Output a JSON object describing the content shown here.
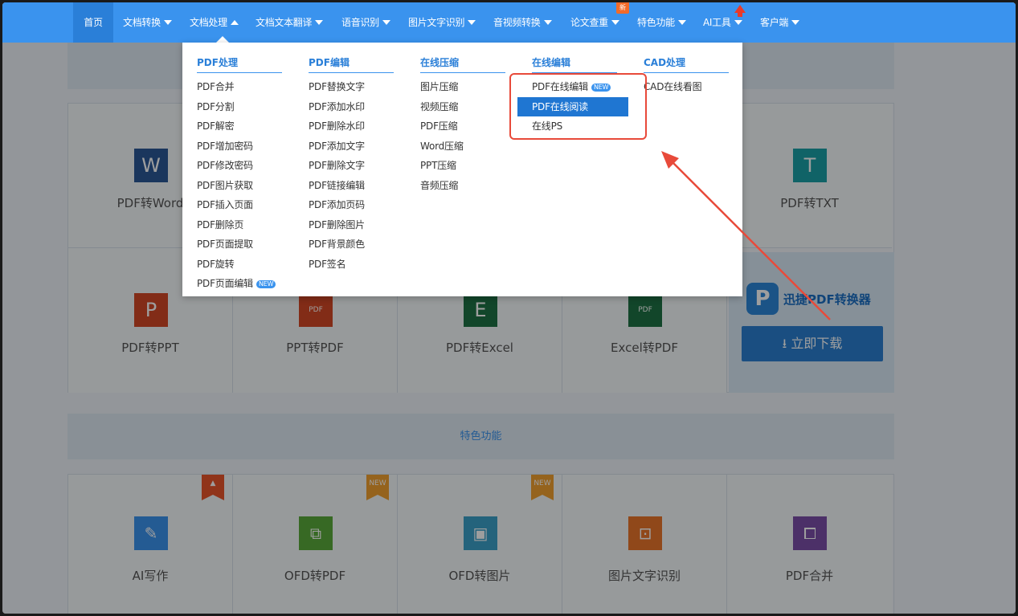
{
  "nav": {
    "items": [
      {
        "label": "首页"
      },
      {
        "label": "文档转换"
      },
      {
        "label": "文档处理"
      },
      {
        "label": "文档文本翻译"
      },
      {
        "label": "语音识别"
      },
      {
        "label": "图片文字识别"
      },
      {
        "label": "音视频转换"
      },
      {
        "label": "论文查重"
      },
      {
        "label": "特色功能"
      },
      {
        "label": "AI工具"
      },
      {
        "label": "客户端"
      }
    ],
    "new_badge": "新"
  },
  "dropdown": {
    "columns": [
      {
        "title": "PDF处理",
        "items": [
          "PDF合并",
          "PDF分割",
          "PDF解密",
          "PDF增加密码",
          "PDF修改密码",
          "PDF图片获取",
          "PDF插入页面",
          "PDF删除页",
          "PDF页面提取",
          "PDF旋转",
          "PDF页面编辑"
        ]
      },
      {
        "title": "PDF编辑",
        "items": [
          "PDF替换文字",
          "PDF添加水印",
          "PDF删除水印",
          "PDF添加文字",
          "PDF删除文字",
          "PDF链接编辑",
          "PDF添加页码",
          "PDF删除图片",
          "PDF背景颜色",
          "PDF签名"
        ]
      },
      {
        "title": "在线压缩",
        "items": [
          "图片压缩",
          "视频压缩",
          "PDF压缩",
          "Word压缩",
          "PPT压缩",
          "音频压缩"
        ]
      },
      {
        "title": "在线编辑",
        "items": [
          "PDF在线编辑",
          "PDF在线阅读",
          "在线PS"
        ]
      },
      {
        "title": "CAD处理",
        "items": [
          "CAD在线看图"
        ]
      }
    ],
    "new_label": "NEW"
  },
  "tiles": {
    "row1": [
      {
        "label": "PDF转Word",
        "icon": "word-icon",
        "glyph": "W",
        "color": "#2b5797"
      },
      {
        "label": "PDF转TXT",
        "icon": "txt-icon",
        "glyph": "T",
        "color": "#1ba1a6"
      }
    ],
    "row2": [
      {
        "label": "PDF转PPT",
        "icon": "ppt-icon",
        "glyph": "P",
        "color": "#d24726"
      },
      {
        "label": "PPT转PDF",
        "icon": "pdf-file-icon",
        "glyph": "PDF",
        "color": "#d24726"
      },
      {
        "label": "PDF转Excel",
        "icon": "excel-icon",
        "glyph": "E",
        "color": "#1e7145"
      },
      {
        "label": "Excel转PDF",
        "icon": "pdf-file-icon",
        "glyph": "PDF",
        "color": "#1e7145"
      }
    ]
  },
  "promo": {
    "title": "迅捷PDF转换器",
    "download_label": "立即下载"
  },
  "features": {
    "band_title": "特色功能",
    "items": [
      {
        "label": "AI写作",
        "icon": "pen-icon",
        "color": "#3a93ee",
        "ribbon": "hot",
        "ribbon_color": "#e8542a"
      },
      {
        "label": "OFD转PDF",
        "icon": "pdf-doc-icon",
        "color": "#5aaa3a",
        "ribbon": "NEW",
        "ribbon_color": "#f0a030"
      },
      {
        "label": "OFD转图片",
        "icon": "image-icon",
        "color": "#3aa0c8",
        "ribbon": "NEW",
        "ribbon_color": "#f0a030"
      },
      {
        "label": "图片文字识别",
        "icon": "scan-icon",
        "color": "#e8742a",
        "ribbon": "",
        "ribbon_color": ""
      },
      {
        "label": "PDF合并",
        "icon": "merge-icon",
        "color": "#7b4ea8",
        "ribbon": "",
        "ribbon_color": ""
      }
    ]
  }
}
